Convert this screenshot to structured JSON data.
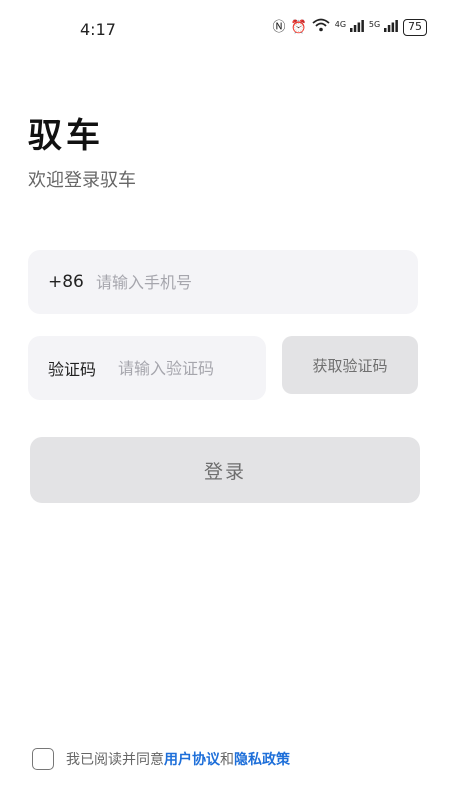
{
  "status_bar": {
    "time": "4:17",
    "nfc_icon": "nfc-icon",
    "alarm_icon": "alarm-icon",
    "wifi_icon": "wifi-icon",
    "signal_4g_label": "4G",
    "signal_5g_label": "5G",
    "battery_level": "75"
  },
  "header": {
    "title": "驭车",
    "subtitle": "欢迎登录驭车"
  },
  "phone": {
    "prefix": "+86",
    "placeholder": "请输入手机号"
  },
  "code": {
    "label": "验证码",
    "placeholder": "请输入验证码",
    "get_code_label": "获取验证码"
  },
  "login": {
    "label": "登录"
  },
  "agreement": {
    "text_prefix": "我已阅读并同意",
    "user_agreement": "用户协议",
    "conjunction": "和",
    "privacy_policy": "隐私政策",
    "checked": false
  },
  "colors": {
    "link": "#1e6fd9",
    "field_bg": "#f4f4f7",
    "button_disabled_bg": "#e3e3e5"
  }
}
